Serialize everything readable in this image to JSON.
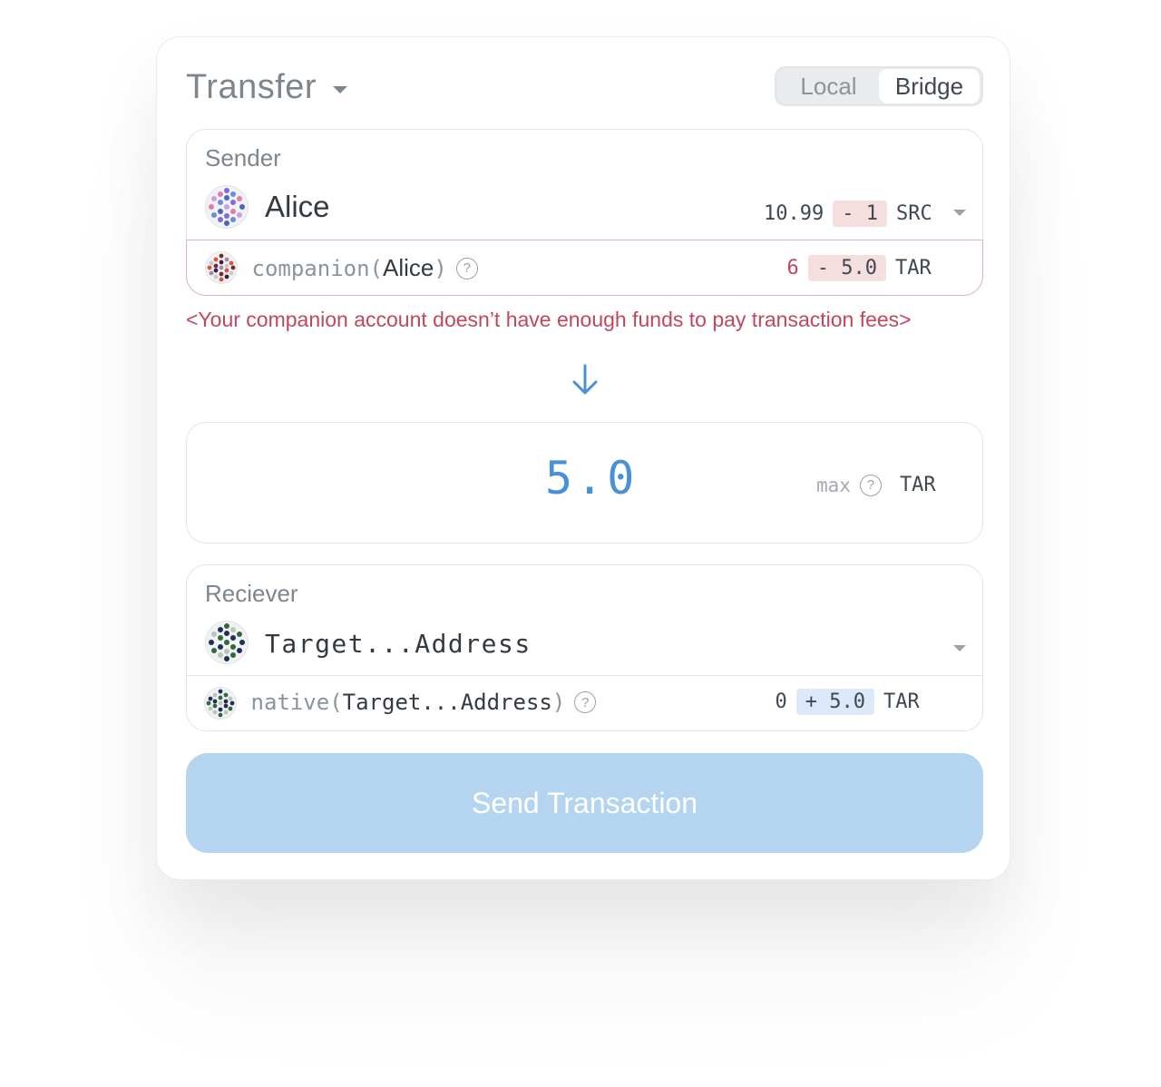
{
  "header": {
    "title": "Transfer",
    "toggle": {
      "options": [
        "Local",
        "Bridge"
      ],
      "active": "Bridge"
    }
  },
  "sender": {
    "label": "Sender",
    "name": "Alice",
    "balance": "10.99",
    "change": "- 1",
    "unit": "SRC",
    "companion": {
      "prefix": "companion(",
      "name": "Alice",
      "suffix": ")",
      "help": "?",
      "balance": "6",
      "change": "- 5.0",
      "unit": "TAR"
    },
    "error": "<Your companion account doesn’t have enough funds to pay transaction fees>"
  },
  "amount": {
    "value": "5.0",
    "max_label": "max",
    "help": "?",
    "unit": "TAR"
  },
  "receiver": {
    "label": "Reciever",
    "name": "Target...Address",
    "native": {
      "prefix": "native(",
      "name": "Target...Address",
      "suffix": ")",
      "help": "?",
      "balance": "0",
      "change": "+ 5.0",
      "unit": "TAR"
    }
  },
  "send_button": {
    "label": "Send Transaction"
  },
  "colors": {
    "accent": "#4a90d9",
    "button_disabled": "#b4d4f0",
    "error": "#c2475d",
    "debit_chip": "#f5dede",
    "credit_chip": "#dbe9fa"
  },
  "icons": {
    "transfer_caret": "caret-down-icon",
    "direction": "arrow-down-icon",
    "help": "question-circle-icon",
    "dropdown": "chevron-down-icon",
    "avatars": "identicon"
  }
}
